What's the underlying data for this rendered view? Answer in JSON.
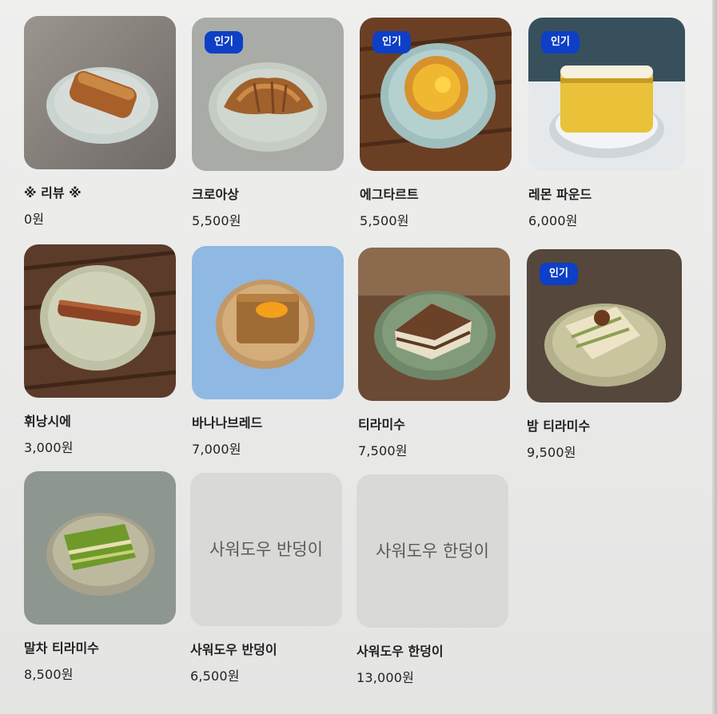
{
  "menu": {
    "items": [
      {
        "name": "※ 리뷰 ※",
        "price": "0원",
        "badge": ""
      },
      {
        "name": "크로아상",
        "price": "5,500원",
        "badge": "인기"
      },
      {
        "name": "에그타르트",
        "price": "5,500원",
        "badge": "인기"
      },
      {
        "name": "레몬 파운드",
        "price": "6,000원",
        "badge": "인기"
      },
      {
        "name": "휘낭시에",
        "price": "3,000원",
        "badge": ""
      },
      {
        "name": "바나나브레드",
        "price": "7,000원",
        "badge": ""
      },
      {
        "name": "티라미수",
        "price": "7,500원",
        "badge": ""
      },
      {
        "name": "밤 티라미수",
        "price": "9,500원",
        "badge": "인기"
      },
      {
        "name": "말차 티라미수",
        "price": "8,500원",
        "badge": ""
      },
      {
        "name": "사워도우 반덩이",
        "price": "6,500원",
        "badge": "",
        "placeholder": "사워도우 반덩이"
      },
      {
        "name": "사워도우 한덩이",
        "price": "13,000원",
        "badge": "",
        "placeholder": "사워도우 한덩이"
      }
    ]
  },
  "colors": {
    "badge": "#0d3fc7",
    "placeholder_bg": "#d9d9d8"
  }
}
